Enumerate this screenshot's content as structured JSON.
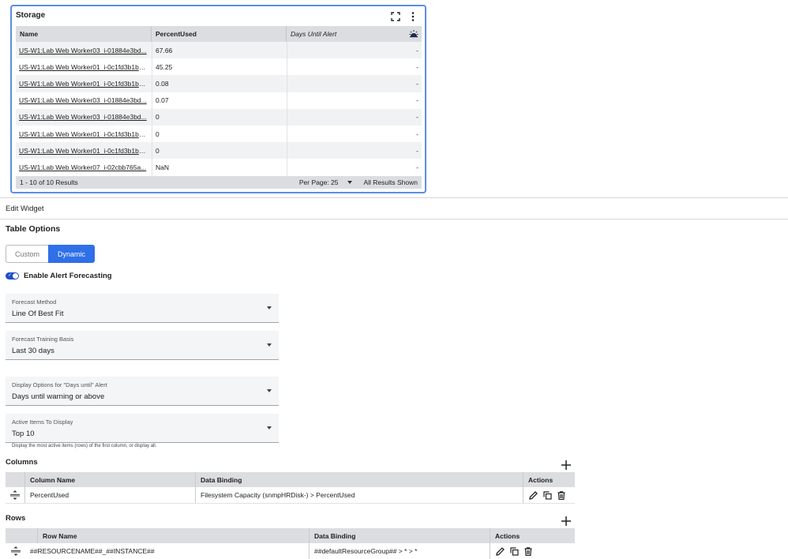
{
  "widget": {
    "title": "Storage",
    "icons": [
      "fullscreen-icon",
      "more-vertical-icon",
      "forecast-icon"
    ],
    "columns": [
      "Name",
      "PercentUsed",
      "Days Until Alert"
    ],
    "rows": [
      {
        "name": "US-W1:Lab Web Worker03_i-01884e3bd...",
        "percent": "67.66",
        "days": "-"
      },
      {
        "name": "US-W1:Lab Web Worker01_i-0c1fd3b1b8...",
        "percent": "45.25",
        "days": "-"
      },
      {
        "name": "US-W1:Lab Web Worker01_i-0c1fd3b1b8...",
        "percent": "0.08",
        "days": "-"
      },
      {
        "name": "US-W1:Lab Web Worker03_i-01884e3bd...",
        "percent": "0.07",
        "days": "-"
      },
      {
        "name": "US-W1:Lab Web Worker03_i-01884e3bd...",
        "percent": "0",
        "days": "-"
      },
      {
        "name": "US-W1:Lab Web Worker01_i-0c1fd3b1b8...",
        "percent": "0",
        "days": "-"
      },
      {
        "name": "US-W1:Lab Web Worker01_i-0c1fd3b1b8...",
        "percent": "0",
        "days": "-"
      },
      {
        "name": "US-W1:Lab Web Worker07_i-02cbb765a...",
        "percent": "NaN",
        "days": "-"
      }
    ],
    "footer": {
      "results": "1 - 10 of 10 Results",
      "per_page": "Per Page: 25",
      "all_results": "All Results Shown"
    }
  },
  "edit": {
    "bar_label": "Edit Widget",
    "table_options_title": "Table Options",
    "segment": {
      "custom": "Custom",
      "dynamic": "Dynamic",
      "selected": "Dynamic"
    },
    "forecast_toggle_label": "Enable Alert Forecasting",
    "forecast_toggle_on": true,
    "forecast_method": {
      "label": "Forecast Method",
      "value": "Line Of Best Fit"
    },
    "training_basis": {
      "label": "Forecast Training Basis",
      "value": "Last 30 days"
    },
    "display_options": {
      "label": "Display Options for \"Days until\" Alert",
      "value": "Days until warning or above"
    },
    "active_items": {
      "label": "Active Items To Display",
      "value": "Top 10"
    },
    "helper_text": "Display the most active items (rows) of the first column, or display all.",
    "columns_section": {
      "title": "Columns",
      "headers": [
        "Column Name",
        "Data Binding",
        "Actions"
      ],
      "rows": [
        {
          "name": "PercentUsed",
          "binding": "Filesystem Capacity (snmpHRDisk-) > PercentUsed"
        }
      ]
    },
    "rows_section": {
      "title": "Rows",
      "headers": [
        "Row Name",
        "Data Binding",
        "Actions"
      ],
      "rows": [
        {
          "name": "##RESOURCENAME##_##INSTANCE##",
          "binding": "##defaultResourceGroup## > * > *"
        }
      ]
    }
  }
}
